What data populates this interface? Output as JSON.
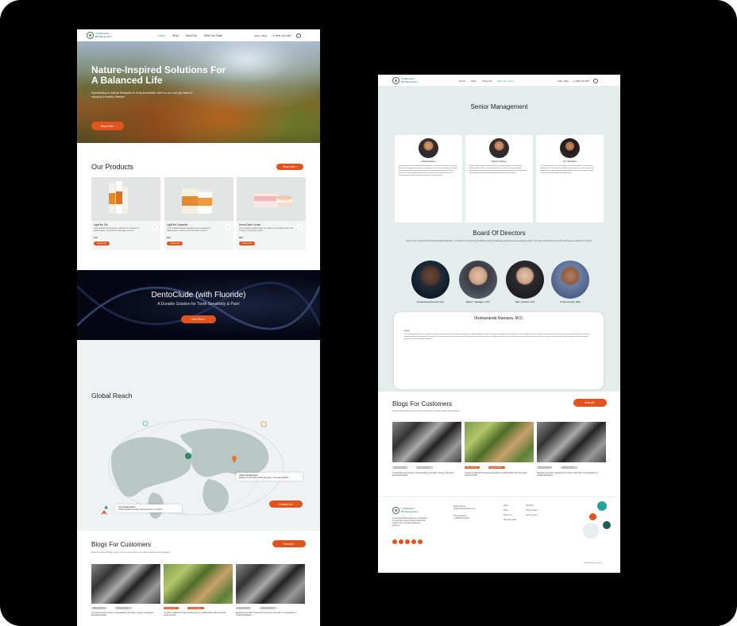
{
  "brand": {
    "name_line1": "Cumberland",
    "name_line2": "Biotherapeutics"
  },
  "nav": {
    "links": [
      "Home",
      "Shop",
      "About Us",
      "Meet Our Team"
    ],
    "lang": "Video / Blog",
    "phone": "+1 (555) 123-4567"
  },
  "hero": {
    "title": "Nature-Inspired Solutions For A Balanced Life",
    "subtitle": "Specializing in natural therapies to bring immediate relief so you can get back to enjoying a healthy lifestyle.",
    "button": "Shop Now"
  },
  "products": {
    "title": "Our Products",
    "shop_button": "Shop Now",
    "items": [
      {
        "name": "LigaFlex Gel",
        "desc": "A formulated topical gel to maintain of a variety of inflammatory concerns for everyday comfort.",
        "price": "$18",
        "button": "Add to Cart"
      },
      {
        "name": "LigaFlex Capsules",
        "desc": "A formulated capsule supplement of a variety of inflammatory concerns for everyday comfort.",
        "price": "$24",
        "button": "Add to Cart"
      },
      {
        "name": "DentoClude Cream",
        "desc": "A formulated topical cream for relief of a sensitive tooth and a range of everyday pains.",
        "price": "$16",
        "button": "Add to Cart"
      }
    ]
  },
  "dento": {
    "title": "DentoClude (with Fluoride)",
    "subtitle": "A Durable Solution for Tooth Sensitivity & Pain!",
    "button": "View More"
  },
  "reach": {
    "title": "Global Reach",
    "india_title": "India Headquarter",
    "india_text": "Balagere Post Varthur Hobli, Bengaluru, Karnataka 560087",
    "us_title": "US Headquarter",
    "us_text": "1600 Amphitheatre Pkwy, Mountain View, CA 94043",
    "contact_button": "Contact Us"
  },
  "blogs": {
    "title": "Blogs For Customers",
    "subtitle": "Read the latest blogs to get to know more about our latest update and upgrades.",
    "view_all": "View All",
    "tag1": "Alternative Health",
    "tag2": "Ayurvedic Medicine",
    "items": [
      "A Comprehensive Guide to Understanding Joint Pain: Causes, Symptoms and Natural Relief",
      "A Guide to Natural Therapeutic Remedies for Inflammation With Ayurvedic Herbs and Diet",
      "Exploring Ayurvedic Treatments for Chronic Joint Pain: A Combination of Traditional Wisdom"
    ]
  },
  "senior": {
    "title": "Senior Management",
    "members": [
      {
        "name": "David Dolvey",
        "text": "David Dolvey joined Cumberland Biotherapeutics as Head of Research and Quality Assurance, shaping the company's strategic focus on research & product innovation. He brings decades of leadership experience in the pharmaceutical and biotech industries and has guided multiple product approvals. He is passionate about science-driven, natural solutions that improve everyday health."
      },
      {
        "name": "Danny Dolvey",
        "text": "Danny Dolvey leads the operations and commercial growth of Cumberland Biotherapeutics. With a strong background in business strategy and global partnerships, he oversees manufacturing, distribution and customer engagement, helping the company bring its therapies to patients across markets."
      },
      {
        "name": "Dr. Shwetha",
        "text": "Dr. Shwetha heads clinical development and medical affairs at Cumberland Biotherapeutics. She combines clinical expertise with research in natural and Ayurvedic formulations, guiding product safety, efficacy studies and scientific communication with healthcare professionals."
      }
    ]
  },
  "board": {
    "title": "Board Of Directors",
    "subtitle": "Discover the minds behind Cumberland Biotherapeutics - committed to transforming healthcare with groundbreaking solutions and pioneering research. Our team unites the best scientific and business expertise in the field.",
    "directors": [
      "Vivekananda Ramana, M.D.",
      "Ralph T. Salvagno, M.D.",
      "Marc Cantillon, M.D",
      "Krishna Reddy, DDS"
    ]
  },
  "bio": {
    "name": "Vivekananda Ramana, M.D.",
    "about": "About",
    "text": "Dr. Vivekananda Ramana is a physician-scientist and entrepreneur with extensive experience in drug development, clinical research and healthcare innovation. He has led multiple research programs from early discovery through clinical validation and has served on advisory boards for biotechnology companies. His work focuses on translating natural and evidence-based therapies into accessible treatments. He has authored numerous publications and continues to mentor young scientists while guiding the strategic scientific direction of Cumberland Biotherapeutics."
  },
  "footer": {
    "about": "Cumberland Biotherapeutics is dedicated to delivering nature-inspired therapeutic solutions for everyday health and wellness.",
    "email_label": "Email Address",
    "email": "info@cumberlandbio.com",
    "phone_label": "Phone Number",
    "phone": "+1 (555) 123-4567",
    "links1": [
      "Home",
      "Shop",
      "About Us",
      "Meet Our Team"
    ],
    "links2": [
      "Our Blog",
      "Privacy Policy",
      "Terms of Use"
    ],
    "copyright": "© 2024 All rights reserved"
  }
}
